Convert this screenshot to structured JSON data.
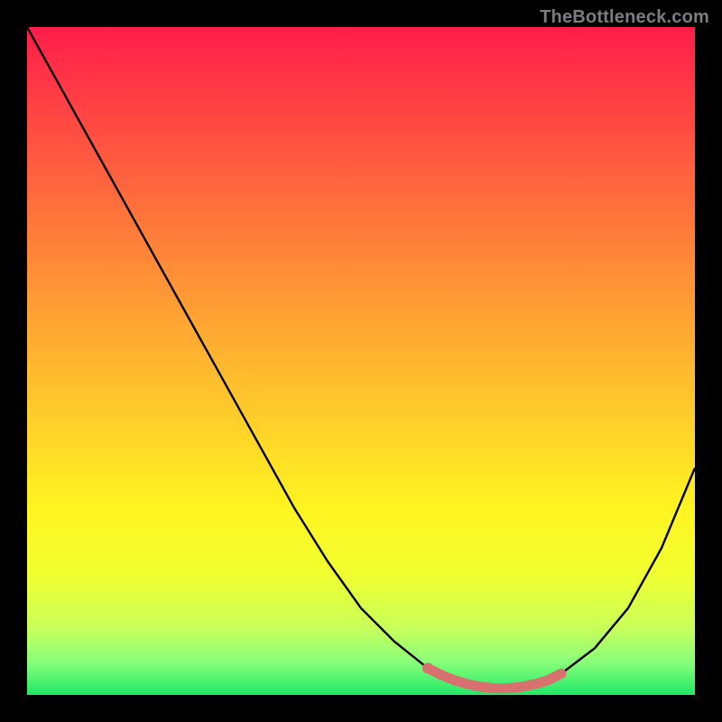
{
  "watermark": "TheBottleneck.com",
  "chart_data": {
    "type": "line",
    "title": "",
    "xlabel": "",
    "ylabel": "",
    "xlim": [
      0,
      100
    ],
    "ylim": [
      0,
      100
    ],
    "x": [
      0,
      5,
      10,
      15,
      20,
      25,
      30,
      35,
      40,
      45,
      50,
      55,
      60,
      62,
      64,
      66,
      68,
      70,
      72,
      74,
      76,
      78,
      80,
      85,
      90,
      95,
      100
    ],
    "values": [
      100,
      91,
      82,
      73,
      64,
      55,
      46,
      37,
      28,
      20,
      13,
      8,
      4,
      3,
      2.2,
      1.6,
      1.2,
      1.0,
      1.0,
      1.2,
      1.6,
      2.2,
      3.2,
      7,
      13,
      22,
      34
    ],
    "highlight_segment": {
      "x": [
        60,
        62,
        64,
        66,
        68,
        70,
        72,
        74,
        76,
        78,
        80
      ],
      "values": [
        4,
        3,
        2.2,
        1.6,
        1.2,
        1.0,
        1.0,
        1.2,
        1.6,
        2.2,
        3.2
      ],
      "color": "#d7706e"
    },
    "gradient_stops": [
      {
        "offset": 0.0,
        "color": "#ff1d4a"
      },
      {
        "offset": 0.15,
        "color": "#ff4b42"
      },
      {
        "offset": 0.3,
        "color": "#ff7a3a"
      },
      {
        "offset": 0.45,
        "color": "#ffa732"
      },
      {
        "offset": 0.6,
        "color": "#ffd22a"
      },
      {
        "offset": 0.72,
        "color": "#fff420"
      },
      {
        "offset": 0.82,
        "color": "#f0ff30"
      },
      {
        "offset": 0.9,
        "color": "#c8ff5a"
      },
      {
        "offset": 0.95,
        "color": "#8aff7a"
      },
      {
        "offset": 1.0,
        "color": "#20e868"
      }
    ]
  }
}
